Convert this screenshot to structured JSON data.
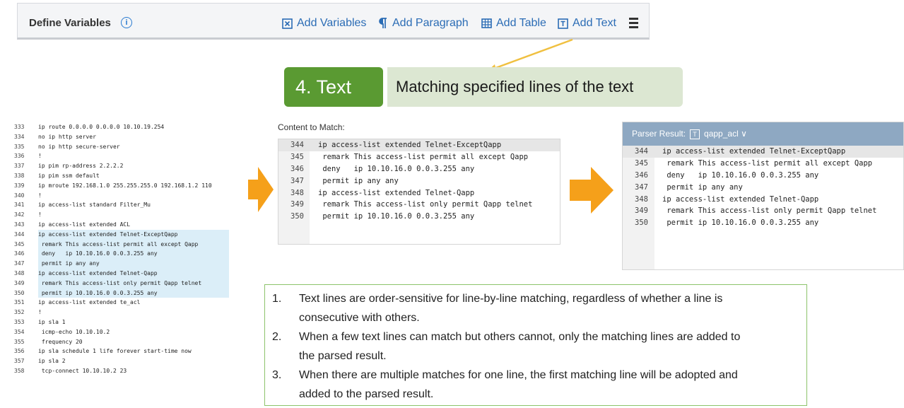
{
  "toolbar": {
    "title": "Define Variables",
    "info_icon": "info-icon",
    "buttons": [
      {
        "label": "Add Variables",
        "icon": "variable-box-icon"
      },
      {
        "label": "Add Paragraph",
        "icon": "pilcrow-icon"
      },
      {
        "label": "Add Table",
        "icon": "table-icon"
      },
      {
        "label": "Add Text",
        "icon": "text-box-icon"
      }
    ],
    "menu_icon": "hamburger-menu-icon"
  },
  "step": {
    "label": "4. Text",
    "description": "Matching specified lines of the text"
  },
  "left_code": {
    "lines": [
      {
        "n": "333",
        "t": "ip route 0.0.0.0 0.0.0.0 10.10.19.254"
      },
      {
        "n": "334",
        "t": "no ip http server"
      },
      {
        "n": "335",
        "t": "no ip http secure-server"
      },
      {
        "n": "336",
        "t": "!"
      },
      {
        "n": "337",
        "t": "ip pim rp-address 2.2.2.2"
      },
      {
        "n": "338",
        "t": "ip pim ssm default"
      },
      {
        "n": "339",
        "t": "ip mroute 192.168.1.0 255.255.255.0 192.168.1.2 110"
      },
      {
        "n": "340",
        "t": "!"
      },
      {
        "n": "341",
        "t": "ip access-list standard Filter_Mu"
      },
      {
        "n": "342",
        "t": "!"
      },
      {
        "n": "343",
        "t": "ip access-list extended ACL"
      },
      {
        "n": "344",
        "t": "ip access-list extended Telnet-ExceptQapp",
        "hl": true
      },
      {
        "n": "345",
        "t": " remark This access-list permit all except Qapp",
        "hl": true
      },
      {
        "n": "346",
        "t": " deny   ip 10.10.16.0 0.0.3.255 any",
        "hl": true
      },
      {
        "n": "347",
        "t": " permit ip any any",
        "hl": true
      },
      {
        "n": "348",
        "t": "ip access-list extended Telnet-Qapp",
        "hl": true
      },
      {
        "n": "349",
        "t": " remark This access-list only permit Qapp telnet",
        "hl": true
      },
      {
        "n": "350",
        "t": " permit ip 10.10.16.0 0.0.3.255 any",
        "hl": true
      },
      {
        "n": "351",
        "t": "ip access-list extended te_acl"
      },
      {
        "n": "352",
        "t": "!"
      },
      {
        "n": "353",
        "t": "ip sla 1"
      },
      {
        "n": "354",
        "t": " icmp-echo 10.10.10.2"
      },
      {
        "n": "355",
        "t": " frequency 20"
      },
      {
        "n": "356",
        "t": "ip sla schedule 1 life forever start-time now"
      },
      {
        "n": "357",
        "t": "ip sla 2"
      },
      {
        "n": "358",
        "t": " tcp-connect 10.10.10.2 23"
      }
    ]
  },
  "content_to_match": {
    "label": "Content to Match:",
    "lines": [
      {
        "n": "344",
        "t": "ip access-list extended Telnet-ExceptQapp"
      },
      {
        "n": "345",
        "t": " remark This access-list permit all except Qapp"
      },
      {
        "n": "346",
        "t": " deny   ip 10.10.16.0 0.0.3.255 any"
      },
      {
        "n": "347",
        "t": " permit ip any any"
      },
      {
        "n": "348",
        "t": "ip access-list extended Telnet-Qapp"
      },
      {
        "n": "349",
        "t": " remark This access-list only permit Qapp telnet"
      },
      {
        "n": "350",
        "t": " permit ip 10.10.16.0 0.0.3.255 any"
      }
    ]
  },
  "parser_result": {
    "label": "Parser Result:",
    "selected": "qapp_acl",
    "lines": [
      {
        "n": "344",
        "t": "ip access-list extended Telnet-ExceptQapp"
      },
      {
        "n": "345",
        "t": " remark This access-list permit all except Qapp"
      },
      {
        "n": "346",
        "t": " deny   ip 10.10.16.0 0.0.3.255 any"
      },
      {
        "n": "347",
        "t": " permit ip any any"
      },
      {
        "n": "348",
        "t": "ip access-list extended Telnet-Qapp"
      },
      {
        "n": "349",
        "t": " remark This access-list only permit Qapp telnet"
      },
      {
        "n": "350",
        "t": " permit ip 10.10.16.0 0.0.3.255 any"
      }
    ]
  },
  "notes": [
    {
      "num": "1.",
      "lines": [
        "Text lines are order-sensitive for line-by-line matching, regardless of whether a line is",
        "consecutive with others."
      ]
    },
    {
      "num": "2.",
      "lines": [
        "When a few text lines can match but others cannot, only the matching lines are added to",
        "the parsed result."
      ]
    },
    {
      "num": "3.",
      "lines": [
        "When there are multiple matches for one line, the first matching line will be adopted and",
        "added to the parsed result."
      ]
    }
  ],
  "colors": {
    "accent_blue": "#2b6cb5",
    "step_green": "#5a9a32",
    "arrow_orange": "#f5a01a",
    "parser_header": "#8ea8c2"
  }
}
